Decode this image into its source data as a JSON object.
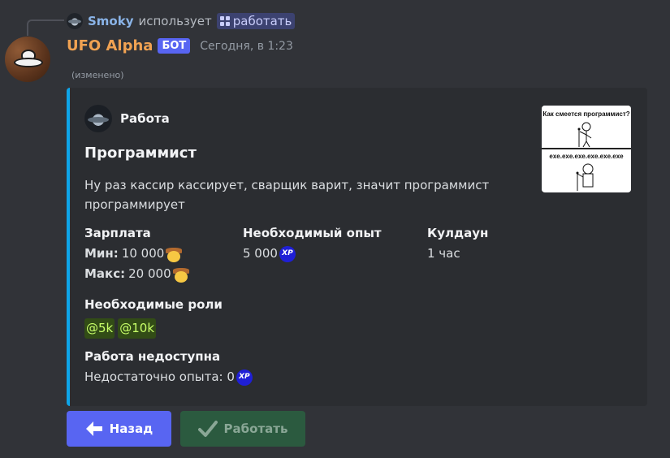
{
  "reply": {
    "user": "Smoky",
    "action": "использует",
    "command": "работать"
  },
  "message": {
    "author": "UFO Alpha",
    "badge": "БОТ",
    "timestamp": "Сегодня, в 1:23",
    "edited": "(изменено)"
  },
  "embed": {
    "accent_color": "#0ea5e9",
    "author": "Работа",
    "title": "Программист",
    "description": "Ну раз кассир кассирует, сварщик варит, значит программист программирует",
    "thumbnail": {
      "top_text": "Как смеется программист?",
      "bottom_text": "exe.exe.exe.exe.exe.exe"
    },
    "fields": {
      "salary": {
        "name": "Зарплата",
        "min_label": "Мин:",
        "min_value": "10 000",
        "max_label": "Макс:",
        "max_value": "20 000",
        "icon": "cowboy-emoji"
      },
      "required_xp": {
        "name": "Необходимый опыт",
        "value": "5 000",
        "icon_label": "XP"
      },
      "cooldown": {
        "name": "Кулдаун",
        "value": "1 час"
      },
      "required_roles": {
        "name": "Необходимые роли",
        "roles": [
          "@5k",
          "@10k"
        ]
      },
      "unavailable": {
        "name": "Работа недоступна",
        "value": "Недостаточно опыта: 0",
        "icon_label": "XP"
      }
    }
  },
  "buttons": {
    "back": {
      "label": "Назад",
      "icon": "arrow-left-icon",
      "color": "#5865f2"
    },
    "work": {
      "label": "Работать",
      "icon": "checkmark-icon",
      "color": "#2b5a3f",
      "disabled": true
    }
  }
}
